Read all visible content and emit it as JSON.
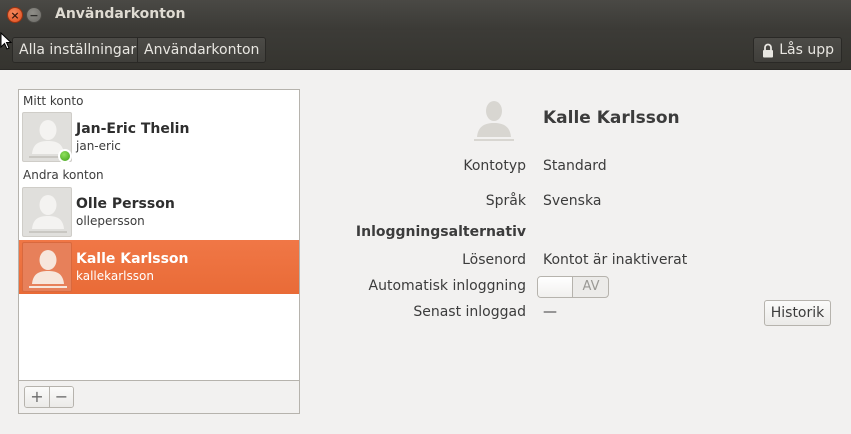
{
  "window": {
    "title": "Användarkonton",
    "close_glyph": "×",
    "minimize_glyph": "−"
  },
  "toolbar": {
    "breadcrumbs": [
      "Alla inställningar",
      "Användarkonton"
    ],
    "unlock_label": "Lås upp",
    "unlock_icon": "lock-icon"
  },
  "user_list": {
    "my_account_label": "Mitt konto",
    "other_accounts_label": "Andra konton",
    "users": [
      {
        "name": "Jan-Eric Thelin",
        "login": "jan-eric",
        "online": true,
        "selected": false
      },
      {
        "name": "Olle Persson",
        "login": "ollepersson",
        "online": false,
        "selected": false
      },
      {
        "name": "Kalle Karlsson",
        "login": "kallekarlsson",
        "online": false,
        "selected": true
      }
    ],
    "add_glyph": "+",
    "remove_glyph": "−"
  },
  "details": {
    "name": "Kalle Karlsson",
    "account_type_label": "Kontotyp",
    "account_type_value": "Standard",
    "language_label": "Språk",
    "language_value": "Svenska",
    "login_options_heading": "Inloggningsalternativ",
    "password_label": "Lösenord",
    "password_value": "Kontot är inaktiverat",
    "autologin_label": "Automatisk inloggning",
    "autologin_state": "AV",
    "last_login_label": "Senast inloggad",
    "last_login_value": "—",
    "history_button": "Historik"
  },
  "colors": {
    "selection": "#e96b37",
    "titlebar": "#3c3b37",
    "online": "#3d9e17"
  }
}
